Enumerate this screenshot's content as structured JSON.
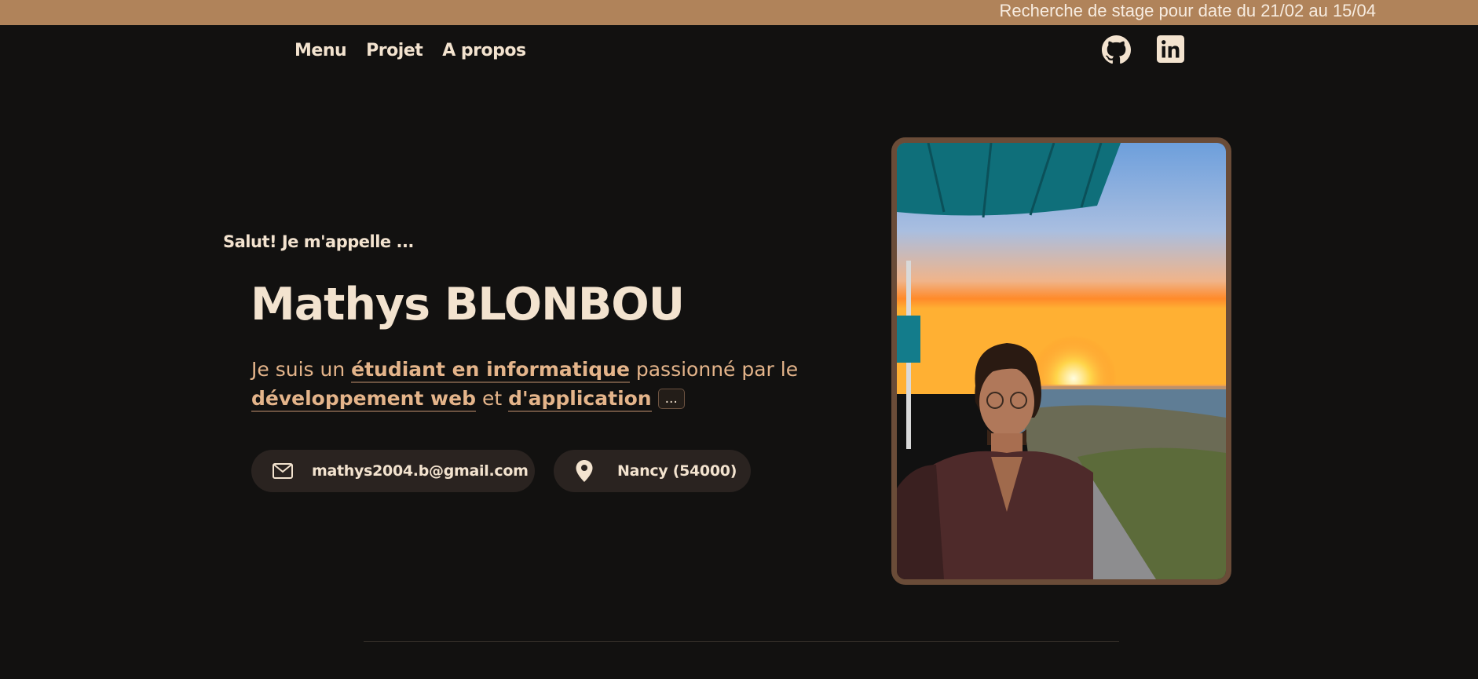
{
  "banner": {
    "text": "Recherche de stage pour date du 21/02 au 15/04"
  },
  "nav": {
    "items": [
      "Menu",
      "Projet",
      "A propos"
    ]
  },
  "social": {
    "github_icon": "github-icon",
    "linkedin_icon": "linkedin-icon"
  },
  "hero": {
    "greeting": "Salut! Je m'appelle ...",
    "name": "Mathys BLONBOU",
    "intro_prefix": "Je suis un ",
    "intro_highlight_1": "étudiant en informatique",
    "intro_mid": " passionné par le ",
    "intro_highlight_2": "développement web",
    "intro_and": " et ",
    "intro_highlight_3": "d'application",
    "more_label": "...",
    "email": "mathys2004.b@gmail.com",
    "location": "Nancy (54000)"
  },
  "colors": {
    "background": "#121110",
    "banner": "#b0835a",
    "text": "#f3e3cf",
    "accent": "#e4b48a",
    "pill": "#2a2320",
    "frame": "#6a4c38"
  }
}
